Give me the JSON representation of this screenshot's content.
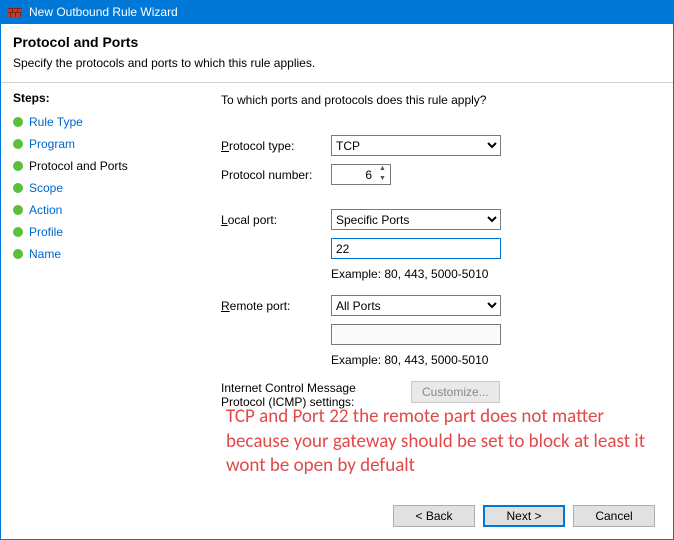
{
  "window": {
    "title": "New Outbound Rule Wizard"
  },
  "header": {
    "title": "Protocol and Ports",
    "subtitle": "Specify the protocols and ports to which this rule applies."
  },
  "steps": {
    "heading": "Steps:",
    "items": [
      {
        "label": "Rule Type",
        "state": "link"
      },
      {
        "label": "Program",
        "state": "link"
      },
      {
        "label": "Protocol and Ports",
        "state": "current"
      },
      {
        "label": "Scope",
        "state": "link"
      },
      {
        "label": "Action",
        "state": "link"
      },
      {
        "label": "Profile",
        "state": "link"
      },
      {
        "label": "Name",
        "state": "link"
      }
    ]
  },
  "main": {
    "question": "To which ports and protocols does this rule apply?",
    "protocol_type": {
      "label_pre": "P",
      "label_rest": "rotocol type:",
      "value": "TCP"
    },
    "protocol_number": {
      "label": "Protocol number:",
      "value": "6"
    },
    "local_port": {
      "label_pre": "L",
      "label_rest": "ocal port:",
      "select_value": "Specific Ports",
      "text_value": "22",
      "example": "Example: 80, 443, 5000-5010"
    },
    "remote_port": {
      "label_pre": "R",
      "label_rest": "emote port:",
      "select_value": "All Ports",
      "text_value": "",
      "example": "Example: 80, 443, 5000-5010"
    },
    "icmp": {
      "label": "Internet Control Message Protocol (ICMP) settings:",
      "button": "Customize..."
    }
  },
  "footer": {
    "back": "< Back",
    "next": "Next >",
    "cancel": "Cancel"
  },
  "annotation": "TCP and Port 22 the remote part does not matter because your gateway should be set to block at least it wont be open by defualt"
}
